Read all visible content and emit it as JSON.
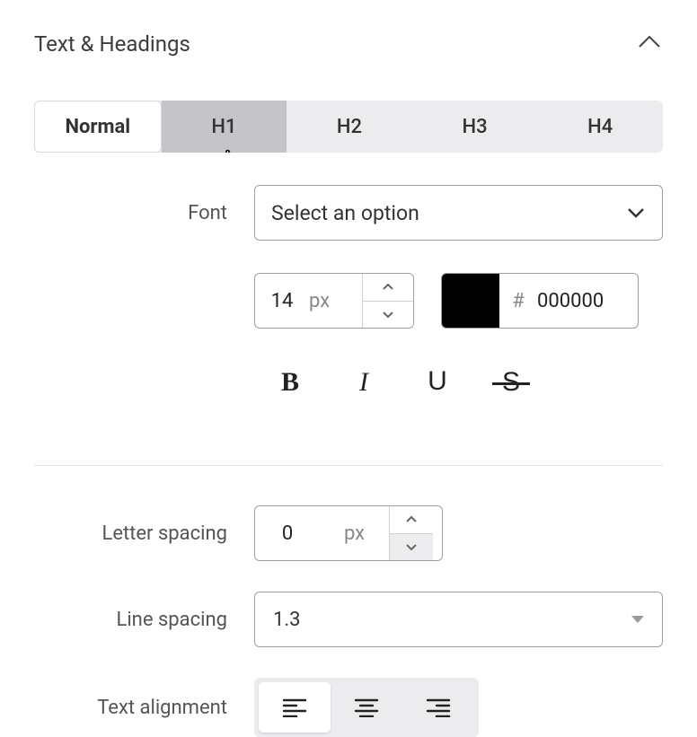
{
  "section": {
    "title": "Text & Headings"
  },
  "tabs": {
    "normal": "Normal",
    "h1": "H1",
    "h2": "H2",
    "h3": "H3",
    "h4": "H4",
    "active": "Normal",
    "hover": "H1"
  },
  "font": {
    "label": "Font",
    "select_placeholder": "Select an option",
    "size_value": "14",
    "size_unit": "px",
    "color_hex": "000000",
    "color_swatch": "#000000",
    "hash": "#"
  },
  "styles": {
    "bold": "B",
    "italic": "I",
    "underline": "U",
    "strike": "S"
  },
  "letter_spacing": {
    "label": "Letter spacing",
    "value": "0",
    "unit": "px"
  },
  "line_spacing": {
    "label": "Line spacing",
    "value": "1.3"
  },
  "text_align": {
    "label": "Text alignment",
    "active": "left"
  }
}
